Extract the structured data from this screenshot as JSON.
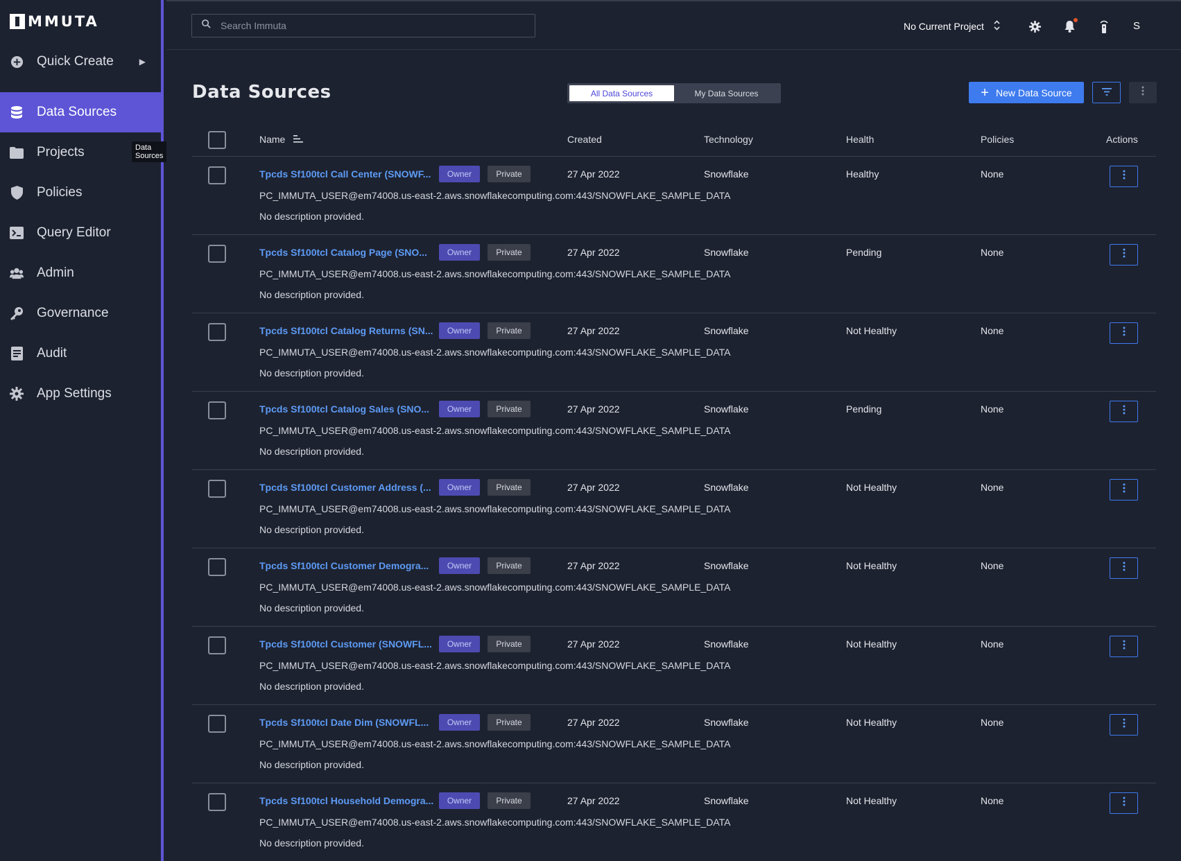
{
  "app": {
    "logo_text": "MMUTA"
  },
  "sidebar": {
    "tooltip": "Data Sources",
    "items": [
      {
        "label": "Quick Create",
        "icon": "plus-circle-icon"
      },
      {
        "label": "Data Sources",
        "icon": "database-icon",
        "active": true
      },
      {
        "label": "Projects",
        "icon": "folder-icon"
      },
      {
        "label": "Policies",
        "icon": "shield-icon"
      },
      {
        "label": "Query Editor",
        "icon": "terminal-icon"
      },
      {
        "label": "Admin",
        "icon": "users-icon"
      },
      {
        "label": "Governance",
        "icon": "key-icon"
      },
      {
        "label": "Audit",
        "icon": "document-icon"
      },
      {
        "label": "App Settings",
        "icon": "gear-icon"
      }
    ]
  },
  "topbar": {
    "search_placeholder": "Search Immuta",
    "project_label": "No Current Project",
    "avatar_initial": "S"
  },
  "main": {
    "title": "Data Sources",
    "toggle": {
      "all": "All Data Sources",
      "mine": "My Data Sources"
    },
    "new_button": "New Data Source",
    "columns": {
      "name": "Name",
      "created": "Created",
      "technology": "Technology",
      "health": "Health",
      "policies": "Policies",
      "actions": "Actions"
    },
    "rows": [
      {
        "name": "Tpcds Sf100tcl Call Center (SNOWF...",
        "owner": "Owner",
        "visibility": "Private",
        "created": "27 Apr 2022",
        "technology": "Snowflake",
        "health": "Healthy",
        "policies": "None",
        "connection": "PC_IMMUTA_USER@em74008.us-east-2.aws.snowflakecomputing.com:443/SNOWFLAKE_SAMPLE_DATA",
        "description": "No description provided."
      },
      {
        "name": "Tpcds Sf100tcl Catalog Page (SNO...",
        "owner": "Owner",
        "visibility": "Private",
        "created": "27 Apr 2022",
        "technology": "Snowflake",
        "health": "Pending",
        "policies": "None",
        "connection": "PC_IMMUTA_USER@em74008.us-east-2.aws.snowflakecomputing.com:443/SNOWFLAKE_SAMPLE_DATA",
        "description": "No description provided."
      },
      {
        "name": "Tpcds Sf100tcl Catalog Returns (SN...",
        "owner": "Owner",
        "visibility": "Private",
        "created": "27 Apr 2022",
        "technology": "Snowflake",
        "health": "Not Healthy",
        "policies": "None",
        "connection": "PC_IMMUTA_USER@em74008.us-east-2.aws.snowflakecomputing.com:443/SNOWFLAKE_SAMPLE_DATA",
        "description": "No description provided."
      },
      {
        "name": "Tpcds Sf100tcl Catalog Sales (SNO...",
        "owner": "Owner",
        "visibility": "Private",
        "created": "27 Apr 2022",
        "technology": "Snowflake",
        "health": "Pending",
        "policies": "None",
        "connection": "PC_IMMUTA_USER@em74008.us-east-2.aws.snowflakecomputing.com:443/SNOWFLAKE_SAMPLE_DATA",
        "description": "No description provided."
      },
      {
        "name": "Tpcds Sf100tcl Customer Address (...",
        "owner": "Owner",
        "visibility": "Private",
        "created": "27 Apr 2022",
        "technology": "Snowflake",
        "health": "Not Healthy",
        "policies": "None",
        "connection": "PC_IMMUTA_USER@em74008.us-east-2.aws.snowflakecomputing.com:443/SNOWFLAKE_SAMPLE_DATA",
        "description": "No description provided."
      },
      {
        "name": "Tpcds Sf100tcl Customer Demogra...",
        "owner": "Owner",
        "visibility": "Private",
        "created": "27 Apr 2022",
        "technology": "Snowflake",
        "health": "Not Healthy",
        "policies": "None",
        "connection": "PC_IMMUTA_USER@em74008.us-east-2.aws.snowflakecomputing.com:443/SNOWFLAKE_SAMPLE_DATA",
        "description": "No description provided."
      },
      {
        "name": "Tpcds Sf100tcl Customer (SNOWFL...",
        "owner": "Owner",
        "visibility": "Private",
        "created": "27 Apr 2022",
        "technology": "Snowflake",
        "health": "Not Healthy",
        "policies": "None",
        "connection": "PC_IMMUTA_USER@em74008.us-east-2.aws.snowflakecomputing.com:443/SNOWFLAKE_SAMPLE_DATA",
        "description": "No description provided."
      },
      {
        "name": "Tpcds Sf100tcl Date Dim (SNOWFL...",
        "owner": "Owner",
        "visibility": "Private",
        "created": "27 Apr 2022",
        "technology": "Snowflake",
        "health": "Not Healthy",
        "policies": "None",
        "connection": "PC_IMMUTA_USER@em74008.us-east-2.aws.snowflakecomputing.com:443/SNOWFLAKE_SAMPLE_DATA",
        "description": "No description provided."
      },
      {
        "name": "Tpcds Sf100tcl Household Demogra...",
        "owner": "Owner",
        "visibility": "Private",
        "created": "27 Apr 2022",
        "technology": "Snowflake",
        "health": "Not Healthy",
        "policies": "None",
        "connection": "PC_IMMUTA_USER@em74008.us-east-2.aws.snowflakecomputing.com:443/SNOWFLAKE_SAMPLE_DATA",
        "description": "No description provided."
      }
    ]
  },
  "colors": {
    "accent": "#5d55d6",
    "primary_button": "#3e7bef",
    "link": "#5d9bf5",
    "background": "#1d2230",
    "notification": "#e0562b"
  }
}
